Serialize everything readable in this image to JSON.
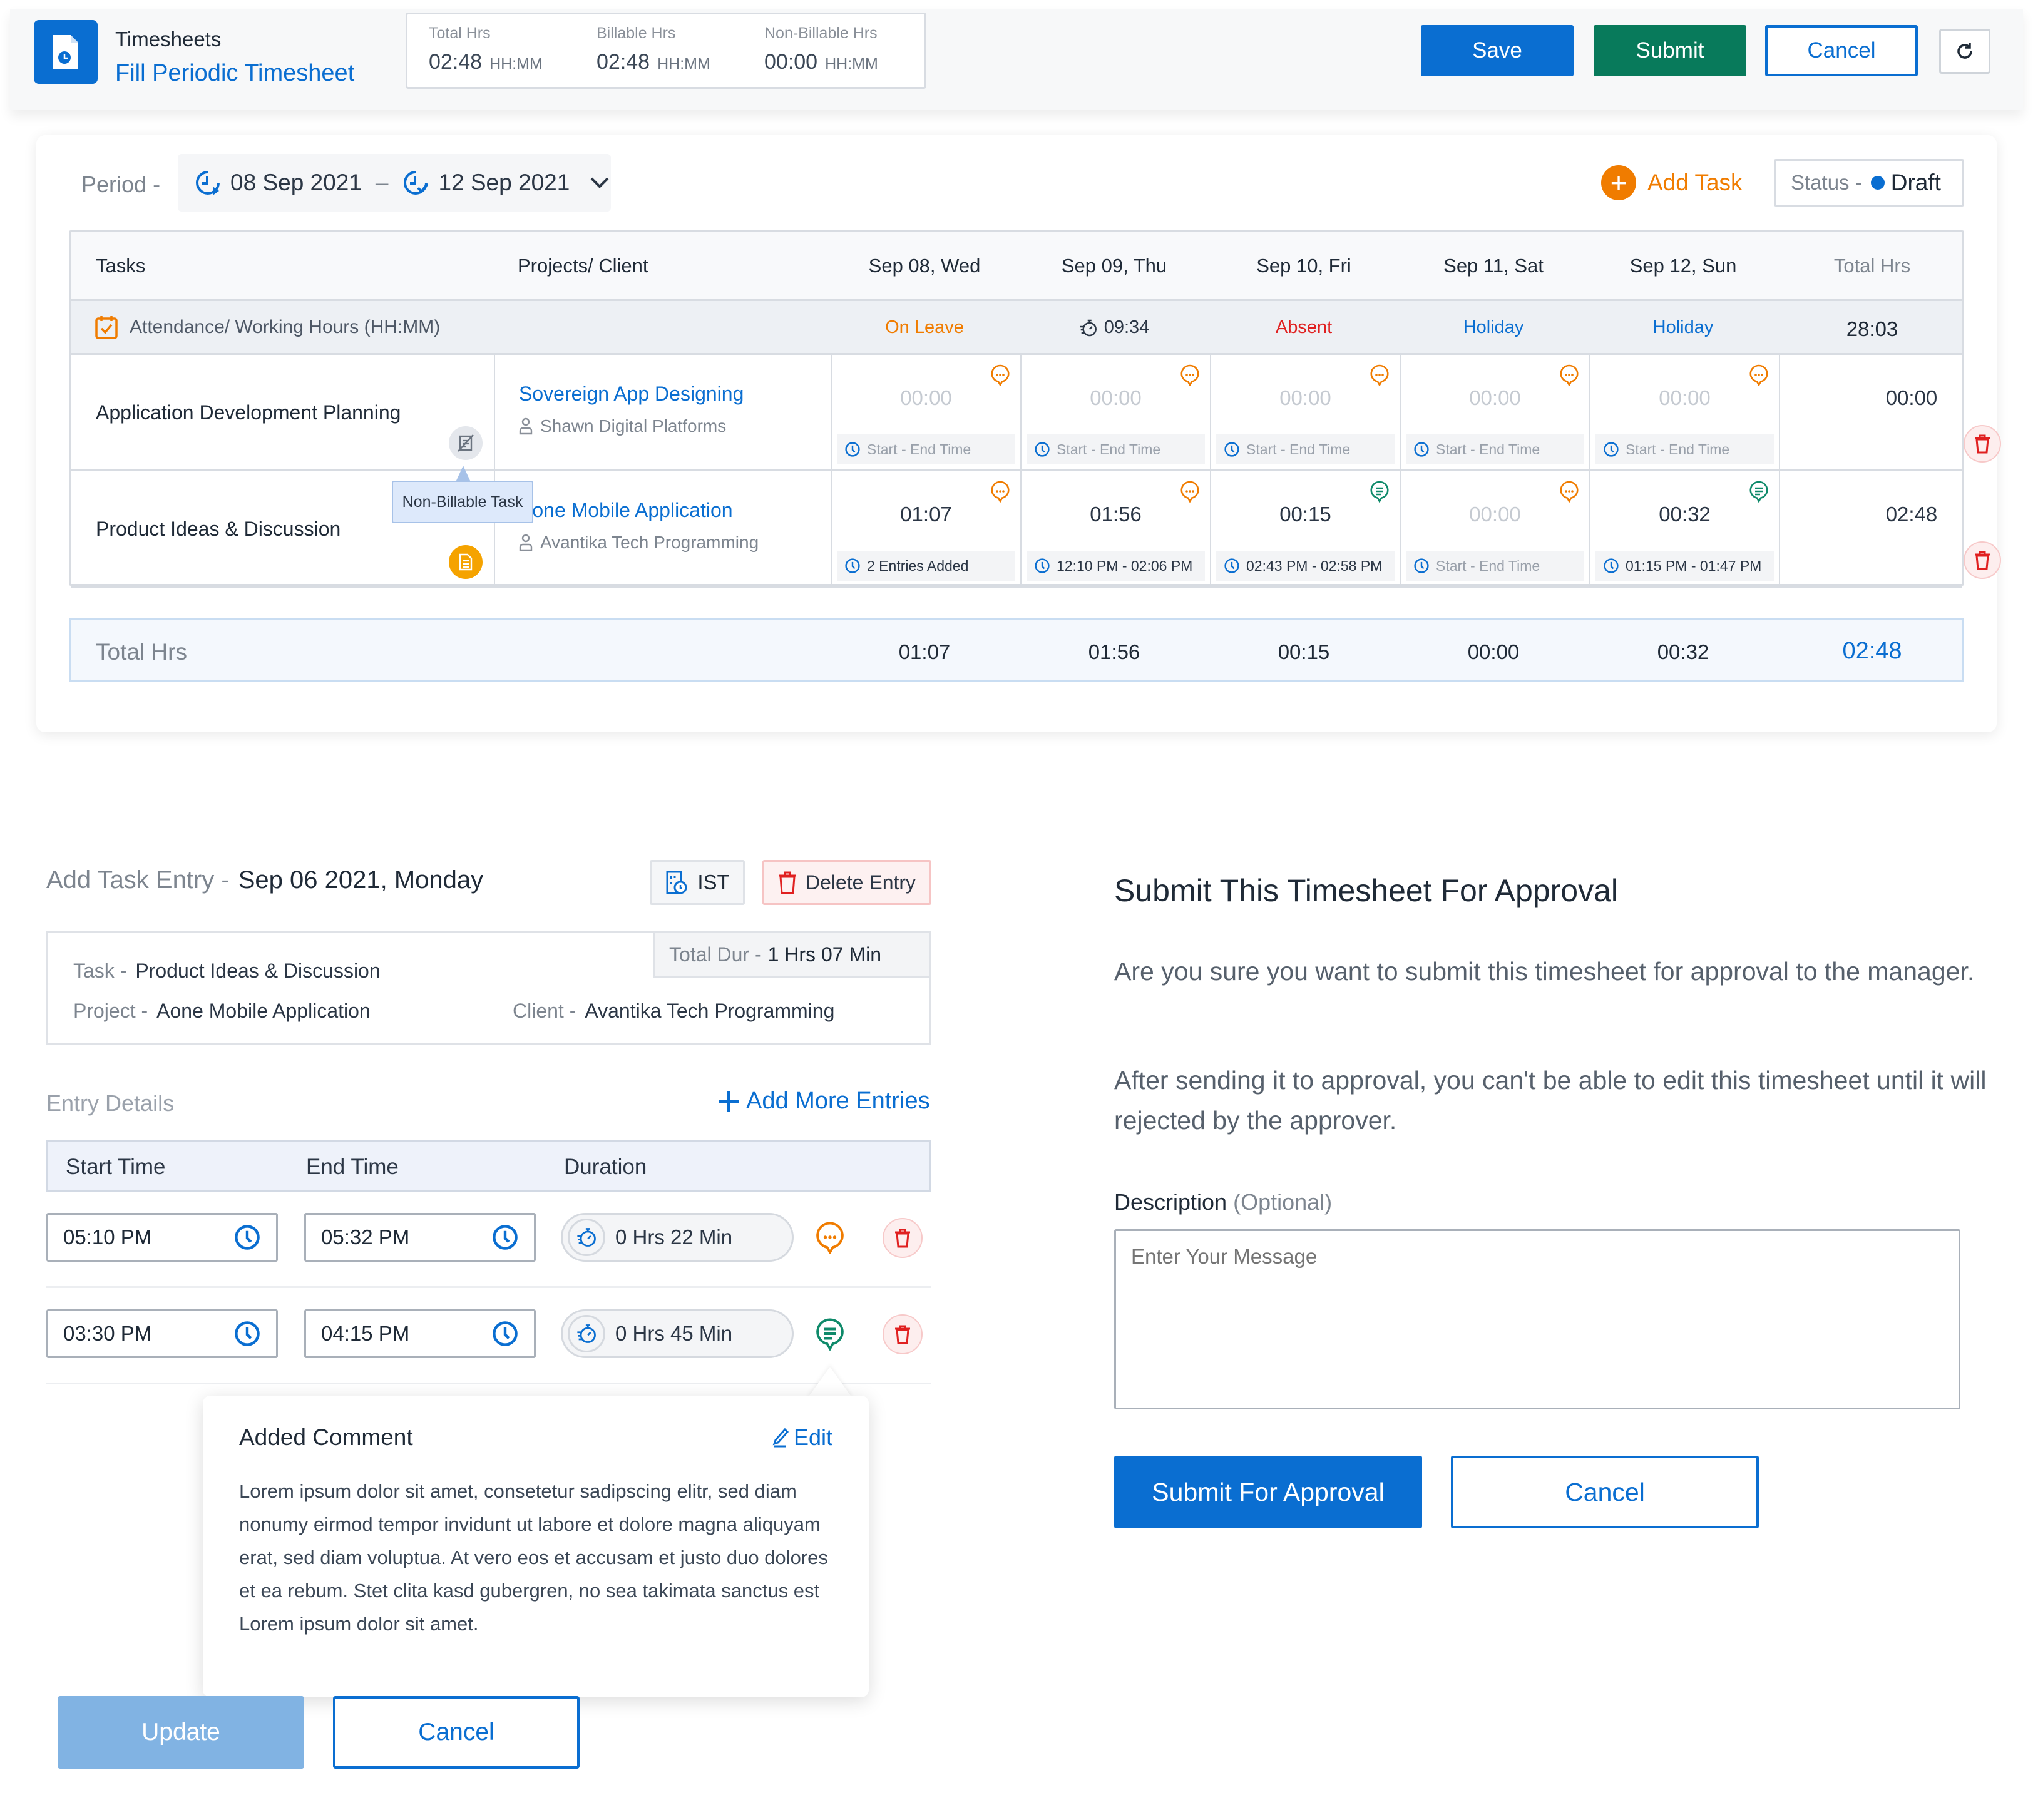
{
  "header": {
    "app_title": "Timesheets",
    "app_subtitle": "Fill Periodic Timesheet",
    "summary": [
      {
        "label": "Total Hrs",
        "value": "02:48",
        "unit": "HH:MM"
      },
      {
        "label": "Billable Hrs",
        "value": "02:48",
        "unit": "HH:MM"
      },
      {
        "label": "Non-Billable Hrs",
        "value": "00:00",
        "unit": "HH:MM"
      }
    ],
    "buttons": {
      "save": "Save",
      "submit": "Submit",
      "cancel": "Cancel"
    },
    "colors": {
      "primary": "#0a6ed1",
      "submit": "#087a5b",
      "accent_orange": "#f07c00",
      "danger": "#e02020"
    }
  },
  "period": {
    "label": "Period -",
    "start": "08 Sep 2021",
    "dash": "–",
    "end": "12 Sep 2021"
  },
  "add_task_label": "Add Task",
  "status": {
    "label": "Status -",
    "value": "Draft"
  },
  "table": {
    "headers": {
      "tasks": "Tasks",
      "projects": "Projects/ Client",
      "days": [
        "Sep 08, Wed",
        "Sep 09, Thu",
        "Sep 10, Fri",
        "Sep 11, Sat",
        "Sep 12, Sun"
      ],
      "total": "Total Hrs"
    },
    "attendance": {
      "label": "Attendance/ Working Hours (HH:MM)",
      "days": [
        {
          "text": "On Leave",
          "color": "#f07c00"
        },
        {
          "text": "09:34",
          "color": "#2b3645"
        },
        {
          "text": "Absent",
          "color": "#e02020"
        },
        {
          "text": "Holiday",
          "color": "#0a6ed1"
        },
        {
          "text": "Holiday",
          "color": "#0a6ed1"
        }
      ],
      "total": "28:03"
    },
    "rows": [
      {
        "task": "Application Development Planning",
        "project": "Sovereign App Designing",
        "client": "Shawn Digital Platforms",
        "badge": "non-billable",
        "days": [
          {
            "value": "00:00",
            "empty": true,
            "time": "Start - End Time",
            "comment": "pending"
          },
          {
            "value": "00:00",
            "empty": true,
            "time": "Start - End Time",
            "comment": "pending"
          },
          {
            "value": "00:00",
            "empty": true,
            "time": "Start - End Time",
            "comment": "pending"
          },
          {
            "value": "00:00",
            "empty": true,
            "time": "Start - End Time",
            "comment": "pending"
          },
          {
            "value": "00:00",
            "empty": true,
            "time": "Start - End Time",
            "comment": "pending"
          }
        ],
        "total": "00:00"
      },
      {
        "task": "Product Ideas & Discussion",
        "project": "Aone Mobile Application",
        "client": "Avantika Tech Programming",
        "badge": "billable",
        "days": [
          {
            "value": "01:07",
            "empty": false,
            "time": "2 Entries Added",
            "comment": "pending"
          },
          {
            "value": "01:56",
            "empty": false,
            "time": "12:10 PM - 02:06 PM",
            "comment": "pending"
          },
          {
            "value": "00:15",
            "empty": false,
            "time": "02:43 PM - 02:58 PM",
            "comment": "added"
          },
          {
            "value": "00:00",
            "empty": true,
            "time": "Start - End Time",
            "comment": "pending"
          },
          {
            "value": "00:32",
            "empty": false,
            "time": "01:15 PM - 01:47 PM",
            "comment": "added"
          }
        ],
        "total": "02:48"
      }
    ],
    "tooltip": "Non-Billable Task",
    "totals": {
      "label": "Total Hrs",
      "days": [
        "01:07",
        "01:56",
        "00:15",
        "00:00",
        "00:32"
      ],
      "grand": "02:48"
    }
  },
  "task_entry": {
    "title_prefix": "Add Task Entry -",
    "title_date": "Sep 06 2021, Monday",
    "timezone": "IST",
    "delete_entry": "Delete Entry",
    "task_label": "Task -",
    "task_value": "Product Ideas & Discussion",
    "project_label": "Project -",
    "project_value": "Aone Mobile Application",
    "client_label": "Client -",
    "client_value": "Avantika Tech Programming",
    "total_dur_label": "Total Dur -",
    "total_dur_value": "1 Hrs  07 Min",
    "entry_details": "Entry Details",
    "add_more": "Add More Entries",
    "columns": {
      "start": "Start Time",
      "end": "End Time",
      "duration": "Duration"
    },
    "entries": [
      {
        "start": "05:10 PM",
        "end": "05:32 PM",
        "duration": "0 Hrs  22 Min",
        "comment": "pending"
      },
      {
        "start": "03:30 PM",
        "end": "04:15 PM",
        "duration": "0 Hrs  45 Min",
        "comment": "added"
      }
    ],
    "comment_popover": {
      "title": "Added Comment",
      "edit": "Edit",
      "body": "Lorem ipsum dolor sit amet, consetetur sadipscing elitr, sed diam nonumy eirmod tempor invidunt ut labore et dolore magna aliquyam erat, sed diam voluptua. At vero eos et accusam et justo duo dolores et ea rebum. Stet clita kasd gubergren, no sea takimata sanctus est Lorem ipsum dolor sit amet."
    },
    "update": "Update",
    "cancel": "Cancel"
  },
  "submit_dialog": {
    "title": "Submit This Timesheet For Approval",
    "para1": "Are you sure you want to submit this timesheet for approval to the manager.",
    "para2": "After sending it to approval, you can't be able to edit this timesheet until it will rejected by the approver.",
    "description_label": "Description",
    "description_optional": "(Optional)",
    "description_placeholder": "Enter Your Message",
    "description_value": "",
    "submit": "Submit For Approval",
    "cancel": "Cancel"
  }
}
